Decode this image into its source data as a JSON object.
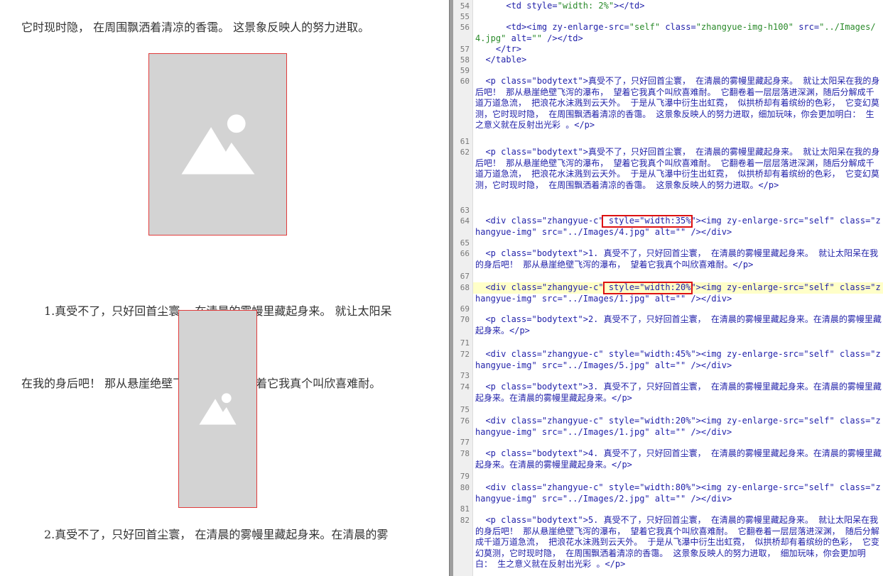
{
  "preview": {
    "para0": "它时现时隐， 在周围飘洒着清凉的香霭。 这景象反映人的努力进取。",
    "para1_line1": "1.真受不了，只好回首尘寰， 在清晨的雾幔里藏起身来。 就让太阳呆",
    "para1_line2": "在我的身后吧！ 那从悬崖绝壁飞泻的瀑布， 望着它我真个叫欣喜难耐。",
    "para2_line1": "2.真受不了，只好回首尘寰， 在清晨的雾幔里藏起身来。在清晨的雾"
  },
  "editor": {
    "lines": [
      {
        "n": "54",
        "html": "      <span class='tg'>&lt;td</span> <span class='at'>style=</span><span class='vl'>\"width: 2%\"</span><span class='tg'>&gt;&lt;/td&gt;</span>"
      },
      {
        "n": "55",
        "html": ""
      },
      {
        "n": "56",
        "html": "      <span class='tg'>&lt;td&gt;&lt;img</span> <span class='at'>zy-enlarge-src=</span><span class='vl'>\"self\"</span> <span class='at'>class=</span><span class='vl'>\"zhangyue-img-h100\"</span> <span class='at'>src=</span><span class='vl'>\"../Images/</span>"
      },
      {
        "n": "",
        "html": "<span class='vl'>4.jpg\"</span> <span class='at'>alt=</span><span class='vl'>\"\"</span> <span class='tg'>/&gt;&lt;/td&gt;</span>"
      },
      {
        "n": "57",
        "html": "    <span class='tg'>&lt;/tr&gt;</span>"
      },
      {
        "n": "58",
        "html": "  <span class='tg'>&lt;/table&gt;</span>"
      },
      {
        "n": "59",
        "html": ""
      }
    ]
  },
  "code_blocks": {
    "b60": "  <p class=\"bodytext\">真受不了，只好回首尘寰， 在清晨的雾幔里藏起身来。 就让太阳呆在我的身后吧！ 那从悬崖绝壁飞泻的瀑布， 望着它我真个叫欣喜难耐。 它翻卷着一层层落进深渊，随后分解成千道万道急流， 把浪花水沫溅到云天外。 于是从飞瀑中衍生出虹霓， 似拱桥却有着缤纷的色彩， 它变幻莫测，它时现时隐， 在周围飘洒着清凉的香霭。 这景象反映人的努力进取，细加玩味，你会更加明白： 生之意义就在反射出光彩 。</p>",
    "b62": "  <p class=\"bodytext\">真受不了，只好回首尘寰， 在清晨的雾幔里藏起身来。 就让太阳呆在我的身后吧！ 那从悬崖绝壁飞泻的瀑布， 望着它我真个叫欣喜难耐。 它翻卷着一层层落进深渊，随后分解成千道万道急流， 把浪花水沫溅到云天外。 于是从飞瀑中衍生出虹霓， 似拱桥却有着缤纷的色彩， 它变幻莫测，它时现时隐， 在周围飘洒着清凉的香霭。 这景象反映人的努力进取。</p>",
    "b64": "  <div class=\"zhangyue-c\" style=\"width:35%\"><img zy-enlarge-src=\"self\" class=\"zhangyue-img\" src=\"../Images/4.jpg\" alt=\"\" /></div>",
    "b66": "  <p class=\"bodytext\">1. 真受不了，只好回首尘寰， 在清晨的雾幔里藏起身来。 就让太阳呆在我的身后吧！ 那从悬崖绝壁飞泻的瀑布， 望着它我真个叫欣喜难耐。</p>",
    "b68": "  <div class=\"zhangyue-c\" style=\"width:20%\"><img zy-enlarge-src=\"self\" class=\"zhangyue-img\" src=\"../Images/1.jpg\" alt=\"\" /></div>",
    "b70": "  <p class=\"bodytext\">2. 真受不了，只好回首尘寰， 在清晨的雾幔里藏起身来。在清晨的雾幔里藏起身来。</p>",
    "b72": "  <div class=\"zhangyue-c\" style=\"width:45%\"><img zy-enlarge-src=\"self\" class=\"zhangyue-img\" src=\"../Images/5.jpg\" alt=\"\" /></div>",
    "b74": "  <p class=\"bodytext\">3. 真受不了，只好回首尘寰， 在清晨的雾幔里藏起身来。在清晨的雾幔里藏起身来。在清晨的雾幔里藏起身来。</p>",
    "b76": "  <div class=\"zhangyue-c\" style=\"width:20%\"><img zy-enlarge-src=\"self\" class=\"zhangyue-img\" src=\"../Images/1.jpg\" alt=\"\" /></div>",
    "b78": "  <p class=\"bodytext\">4. 真受不了，只好回首尘寰， 在清晨的雾幔里藏起身来。在清晨的雾幔里藏起身来。在清晨的雾幔里藏起身来。</p>",
    "b80": "  <div class=\"zhangyue-c\" style=\"width:80%\"><img zy-enlarge-src=\"self\" class=\"zhangyue-img\" src=\"../Images/2.jpg\" alt=\"\" /></div>",
    "b82": "  <p class=\"bodytext\">5. 真受不了，只好回首尘寰， 在清晨的雾幔里藏起身来。 就让太阳呆在我的身后吧！ 那从悬崖绝壁飞泻的瀑布， 望着它我真个叫欣喜难耐。 它翻卷着一层层落进深渊， 随后分解成千道万道急流， 把浪花水沫溅到云天外。 于是从飞瀑中衍生出虹霓， 似拱桥却有着缤纷的色彩， 它变幻莫测，它时现时隐， 在周围飘洒着清凉的香霭。 这景象反映人的努力进取， 细加玩味，你会更加明白： 生之意义就在反射出光彩 。</p>"
  },
  "line_numbers": [
    "54",
    "55",
    "56",
    "57",
    "58",
    "59",
    "60",
    "61",
    "62",
    "63",
    "64",
    "65",
    "66",
    "67",
    "68",
    "69",
    "70",
    "71",
    "72",
    "73",
    "74",
    "75",
    "76",
    "77",
    "78",
    "79",
    "80",
    "81",
    "82"
  ],
  "colors": {
    "highlight": "#ffffc8",
    "selection_box": "#dd1111",
    "image_border": "#e03b3b",
    "image_fill": "#d3d3d3"
  }
}
